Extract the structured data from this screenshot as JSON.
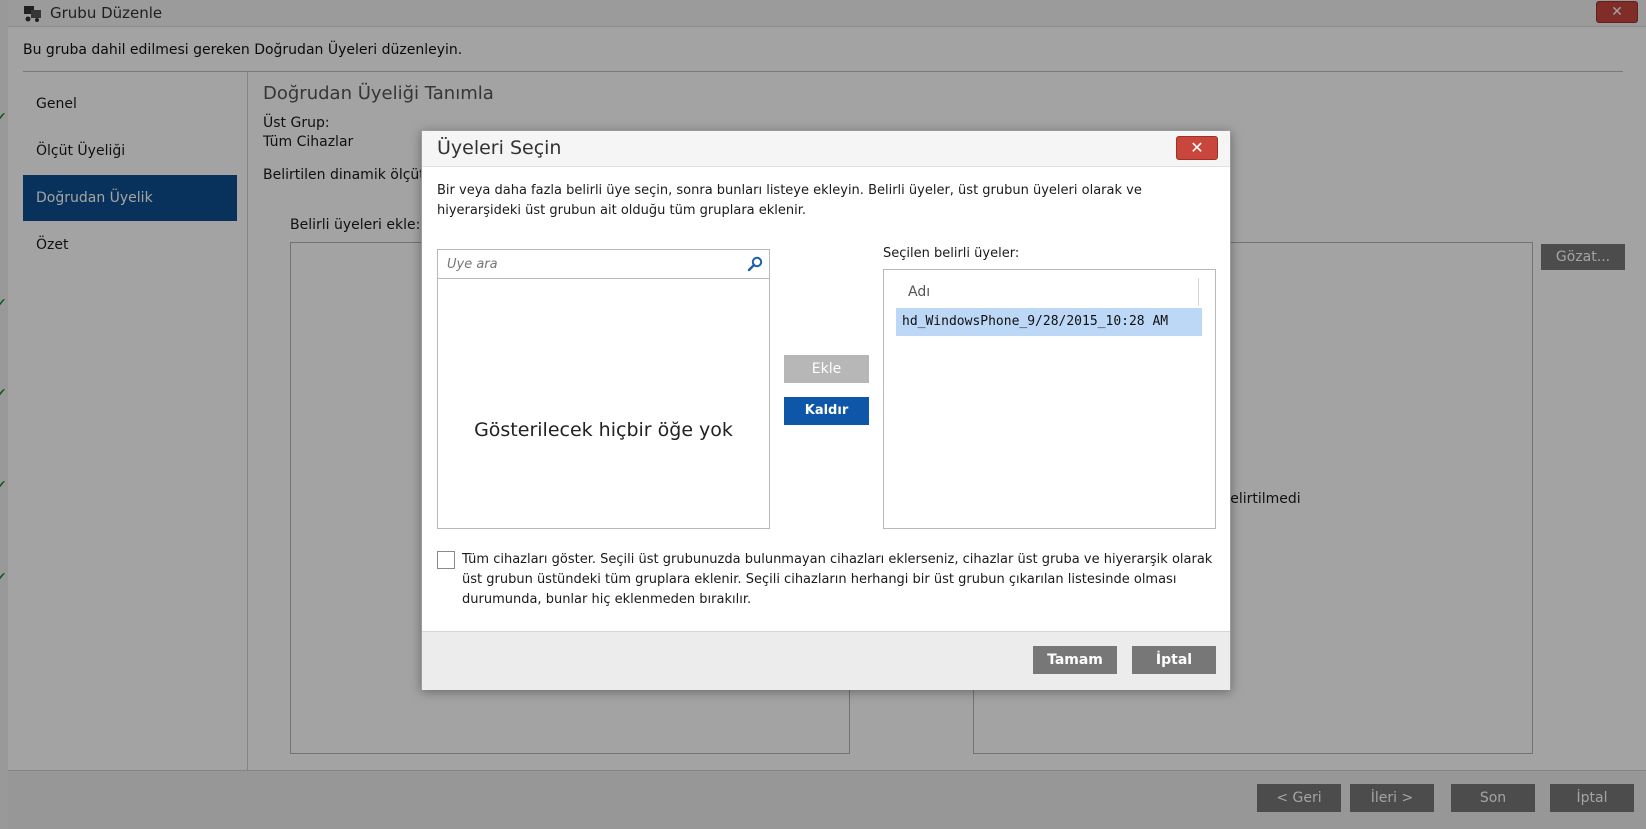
{
  "window": {
    "title": "Grubu Düzenle",
    "close_label": "✕",
    "instruction": "Bu gruba dahil edilmesi gereken Doğrudan Üyeleri düzenleyin."
  },
  "nav": {
    "items": [
      {
        "label": "Genel"
      },
      {
        "label": "Ölçüt Üyeliği"
      },
      {
        "label": "Doğrudan Üyelik",
        "active": true
      },
      {
        "label": "Özet"
      }
    ]
  },
  "content": {
    "section_title": "Doğrudan Üyeliği Tanımla",
    "parent_group_label": "Üst Grup:",
    "parent_group_value": "Tüm Cihazlar",
    "dynamic_label_partial": "Belirtilen dinamik ölçüt",
    "add_members_label": "Belirli üyeleri ekle:",
    "browse_button": "Gözat...",
    "not_specified_partial": "i belirtilmedi"
  },
  "footer": {
    "back": "< Geri",
    "next": "İleri >",
    "finish": "Son",
    "cancel": "İptal"
  },
  "dialog": {
    "title": "Üyeleri Seçin",
    "close_label": "✕",
    "description": "Bir veya daha fazla belirli üye seçin, sonra bunları listeye ekleyin. Belirli üyeler, üst grubun üyeleri olarak ve hiyerarşideki üst grubun ait olduğu tüm gruplara eklenir.",
    "search_placeholder": "Üye ara",
    "empty_text": "Gösterilecek hiçbir öğe yok",
    "add_button": "Ekle",
    "remove_button": "Kaldır",
    "selected_label": "Seçilen belirli üyeler:",
    "column_header": "Adı",
    "selected_items": [
      "hd_WindowsPhone_9/28/2015_10:28 AM"
    ],
    "show_all_checked": false,
    "show_all_text": "Tüm cihazları göster. Seçili üst grubunuzda bulunmayan cihazları eklerseniz, cihazlar üst gruba ve hiyerarşik olarak üst grubun üstündeki tüm gruplara eklenir. Seçili cihazların herhangi bir üst grubun çıkarılan listesinde olması durumunda, bunlar hiç eklenmeden bırakılır.",
    "ok_button": "Tamam",
    "cancel_button": "İptal"
  },
  "colors": {
    "accent": "#0e4f8f",
    "remove_button": "#0e57a8",
    "close_red": "#c9463d",
    "selection": "#bcd8f6",
    "check_green": "#1b8a2e"
  }
}
